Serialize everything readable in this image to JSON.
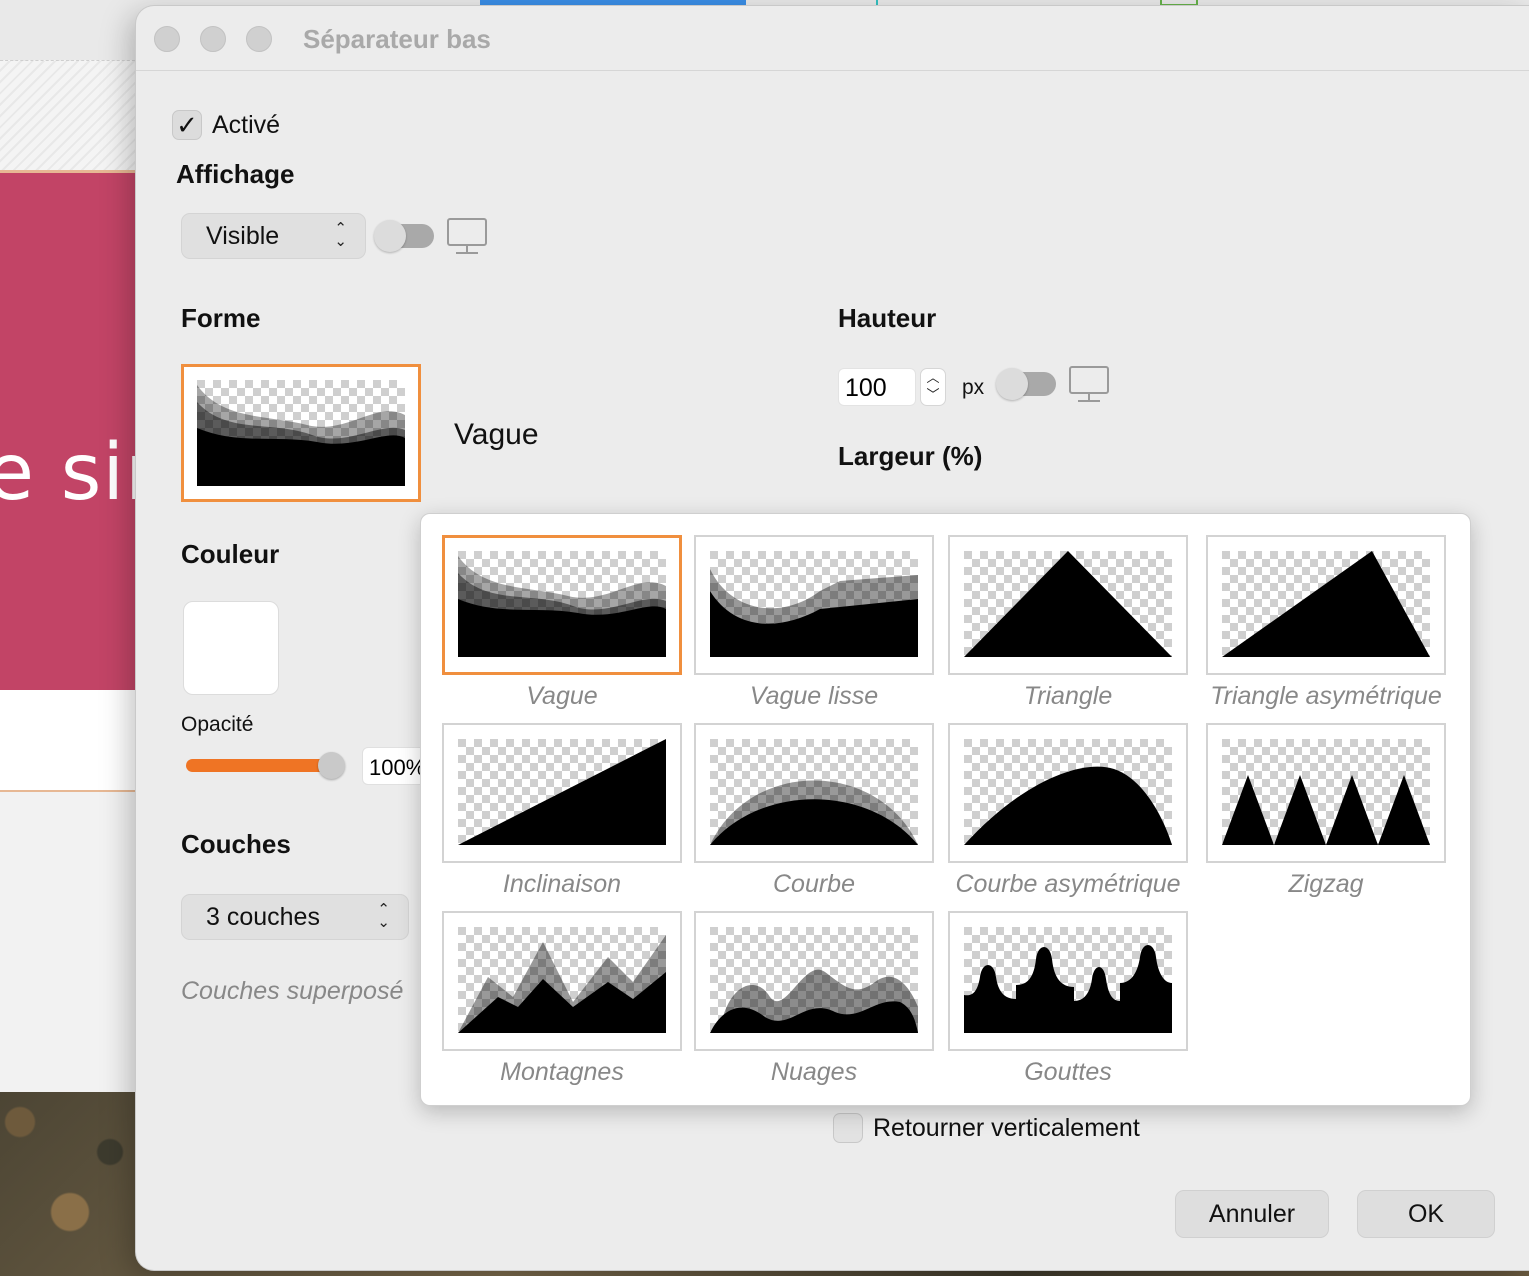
{
  "background": {
    "banner_text": "e sin"
  },
  "window": {
    "title": "Séparateur bas"
  },
  "enabled": {
    "label": "Activé",
    "checked": true
  },
  "display": {
    "heading": "Affichage",
    "visibility_value": "Visible"
  },
  "shape": {
    "heading": "Forme",
    "selected_name": "Vague"
  },
  "height": {
    "heading": "Hauteur",
    "value": "100",
    "unit": "px"
  },
  "width": {
    "heading": "Largeur (%)"
  },
  "color": {
    "heading": "Couleur",
    "value": "#ffffff",
    "opacity_label": "Opacité",
    "opacity_value": "100%",
    "opacity_fraction": 1.0
  },
  "layers": {
    "heading": "Couches",
    "value": "3 couches",
    "hint": "Couches superposé"
  },
  "flip": {
    "label": "Retourner verticalement",
    "checked": false
  },
  "buttons": {
    "cancel": "Annuler",
    "ok": "OK"
  },
  "shape_options": [
    {
      "id": "vague",
      "label": "Vague",
      "selected": true
    },
    {
      "id": "vague-lisse",
      "label": "Vague lisse",
      "selected": false
    },
    {
      "id": "triangle",
      "label": "Triangle",
      "selected": false
    },
    {
      "id": "triangle-asym",
      "label": "Triangle asymétrique",
      "selected": false
    },
    {
      "id": "inclinaison",
      "label": "Inclinaison",
      "selected": false
    },
    {
      "id": "courbe",
      "label": "Courbe",
      "selected": false
    },
    {
      "id": "courbe-asym",
      "label": "Courbe asymétrique",
      "selected": false
    },
    {
      "id": "zigzag",
      "label": "Zigzag",
      "selected": false
    },
    {
      "id": "montagnes",
      "label": "Montagnes",
      "selected": false
    },
    {
      "id": "nuages",
      "label": "Nuages",
      "selected": false
    },
    {
      "id": "gouttes",
      "label": "Gouttes",
      "selected": false
    }
  ],
  "colors": {
    "accent_orange": "#f08f3e",
    "slider_orange": "#ef7424",
    "banner": "#c24466"
  }
}
